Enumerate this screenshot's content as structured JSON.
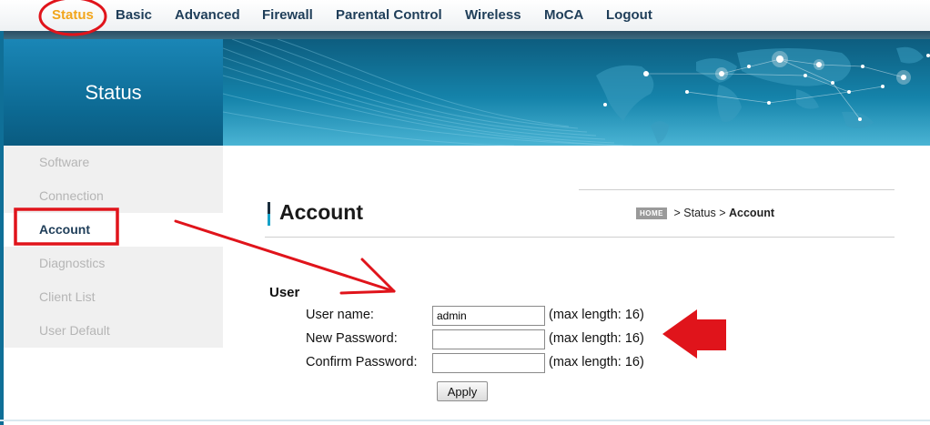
{
  "nav": {
    "items": [
      {
        "label": "Status",
        "active": true
      },
      {
        "label": "Basic"
      },
      {
        "label": "Advanced"
      },
      {
        "label": "Firewall"
      },
      {
        "label": "Parental Control"
      },
      {
        "label": "Wireless"
      },
      {
        "label": "MoCA"
      },
      {
        "label": "Logout"
      }
    ]
  },
  "sidebar": {
    "title": "Status",
    "items": [
      {
        "label": "Software"
      },
      {
        "label": "Connection"
      },
      {
        "label": "Account",
        "active": true
      },
      {
        "label": "Diagnostics"
      },
      {
        "label": "Client List"
      },
      {
        "label": "User Default"
      }
    ]
  },
  "page": {
    "title": "Account",
    "breadcrumb": {
      "home": "HOME",
      "sep1": ">",
      "parent": "Status",
      "sep2": ">",
      "current": "Account"
    }
  },
  "user_section": {
    "title": "User",
    "fields": [
      {
        "label": "User name:",
        "value": "admin",
        "hint": "(max length: 16)"
      },
      {
        "label": "New Password:",
        "value": "",
        "hint": "(max length: 16)"
      },
      {
        "label": "Confirm Password:",
        "value": "",
        "hint": "(max length: 16)"
      }
    ],
    "apply_label": "Apply"
  },
  "colors": {
    "active_nav": "#f2a51b",
    "nav_text": "#1f3e59",
    "annotation_red": "#e0141b",
    "status_panel": "#0c6891"
  }
}
